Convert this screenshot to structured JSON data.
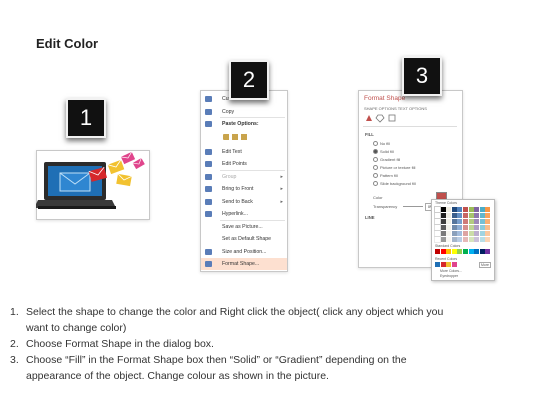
{
  "page": {
    "title": "Edit Color"
  },
  "badges": [
    "1",
    "2",
    "3"
  ],
  "context_menu": {
    "items": [
      {
        "label": "Cut",
        "icon": "scissors-icon",
        "dim": false,
        "arrow": false
      },
      {
        "label": "Copy",
        "icon": "copy-icon",
        "dim": false,
        "arrow": false
      },
      {
        "label": "Paste Options:",
        "icon": "paste-icon",
        "dim": false,
        "arrow": false,
        "bold": true
      },
      {
        "label": "",
        "icon": "paste-options-icons",
        "dim": false,
        "arrow": false
      },
      {
        "label": "Edit Text",
        "icon": "edit-text-icon",
        "dim": false,
        "arrow": false
      },
      {
        "label": "Edit Points",
        "icon": "edit-points-icon",
        "dim": false,
        "arrow": false
      },
      {
        "label": "Group",
        "icon": "group-icon",
        "dim": true,
        "arrow": true
      },
      {
        "label": "Bring to Front",
        "icon": "bring-front-icon",
        "dim": false,
        "arrow": true
      },
      {
        "label": "Send to Back",
        "icon": "send-back-icon",
        "dim": false,
        "arrow": true
      },
      {
        "label": "Hyperlink...",
        "icon": "hyperlink-icon",
        "dim": false,
        "arrow": false
      },
      {
        "label": "Save as Picture...",
        "icon": "",
        "dim": false,
        "arrow": false
      },
      {
        "label": "Set as Default Shape",
        "icon": "",
        "dim": false,
        "arrow": false
      },
      {
        "label": "Size and Position...",
        "icon": "size-position-icon",
        "dim": false,
        "arrow": false
      },
      {
        "label": "Format Shape...",
        "icon": "format-shape-icon",
        "dim": false,
        "arrow": false,
        "highlight": true
      }
    ]
  },
  "format_shape": {
    "title": "Format Shape",
    "subtitle": "SHAPE OPTIONS   TEXT OPTIONS",
    "fill_section": "FILL",
    "fill_options": [
      "No fill",
      "Solid fill",
      "Gradient fill",
      "Picture or texture fill",
      "Pattern fill",
      "Slide background fill"
    ],
    "color_label": "Color",
    "transparency_label": "Transparency",
    "transparency_value": "0%",
    "line_section": "LINE",
    "popup": {
      "theme_label": "Theme Colors",
      "standard_label": "Standard Colors",
      "recent_label": "Recent Colors",
      "more_label": "More Colors...",
      "eyedropper_label": "Eyedropper",
      "more_button": "More"
    }
  },
  "instructions": [
    {
      "num": "1.",
      "lines": [
        "Select the shape to change the color and Right click the object( click any object which you",
        "want to change color)"
      ]
    },
    {
      "num": "2.",
      "lines": [
        "Choose Format Shape in the dialog box."
      ]
    },
    {
      "num": "3.",
      "lines": [
        "Choose “Fill” in the Format Shape box then “Solid” or “Gradient” depending on the",
        "appearance of the object. Change colour as shown in the picture."
      ]
    }
  ],
  "colors": {
    "badge_bg": "#111111",
    "accent": "#c0504d",
    "laptop_screen": "#1f6fb5",
    "envelope_red": "#d6282b",
    "envelope_yellow": "#f2c230",
    "envelope_pink": "#e0458c",
    "menu_highlight": "#fde0d0"
  }
}
